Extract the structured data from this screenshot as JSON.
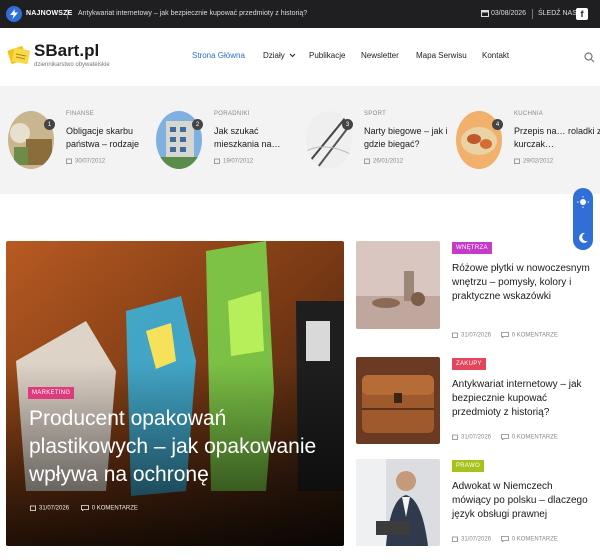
{
  "topbar": {
    "latest_label": "NAJNOWSZE",
    "ticker_text": "Antykwariat internetowy – jak bezpiecznie kupować przedmioty z historią?",
    "date": "03/08/2026",
    "follow_label": "ŚLEDŹ NAS",
    "facebook_glyph": "f"
  },
  "site": {
    "name": "SBart.pl",
    "tagline": "dziennikarstwo obywatelskie"
  },
  "nav": {
    "home": "Strona Główna",
    "sections": "Działy",
    "publications": "Publikacje",
    "newsletter": "Newsletter",
    "sitemap": "Mapa Serwisu",
    "contact": "Kontakt"
  },
  "featured": [
    {
      "num": "1",
      "category": "FINANSE",
      "title": "Obligacje skarbu państwa – rodzaje",
      "date": "30/07/2012"
    },
    {
      "num": "2",
      "category": "PORADNIKI",
      "title": "Jak szukać mieszkania na…",
      "date": "19/07/2012"
    },
    {
      "num": "3",
      "category": "SPORT",
      "title": "Narty biegowe – jak i gdzie biegać?",
      "date": "26/01/2012"
    },
    {
      "num": "4",
      "category": "KUCHNIA",
      "title": "Przepis na… roladki z kurczak…",
      "date": "29/02/2012"
    }
  ],
  "hero": {
    "category": "MARKETING",
    "title": "Producent opakowań plastikowych – jak opakowanie wpływa na ochronę",
    "date": "31/07/2026",
    "comments": "0 KOMENTARZE"
  },
  "side_posts": [
    {
      "category": "WNĘTRZA",
      "color": "#c43ac9",
      "title": "Różowe płytki w nowoczesnym wnętrzu – pomysły, kolory i praktyczne wskazówki",
      "date": "31/07/2026",
      "comments": "0 KOMENTARZE"
    },
    {
      "category": "ZAKUPY",
      "color": "#e2455c",
      "title": "Antykwariat internetowy – jak bezpiecznie kupować przedmioty z historią?",
      "date": "31/07/2026",
      "comments": "0 KOMENTARZE"
    },
    {
      "category": "PRAWO",
      "color": "#a8c21c",
      "title": "Adwokat w Niemczech mówiący po polsku – dlaczego język obsługi prawnej",
      "date": "31/07/2026",
      "comments": "0 KOMENTARZE"
    }
  ],
  "colors": {
    "accent": "#2f6fd6",
    "dark": "#1f1f22",
    "marketing": "#e03a7f"
  }
}
